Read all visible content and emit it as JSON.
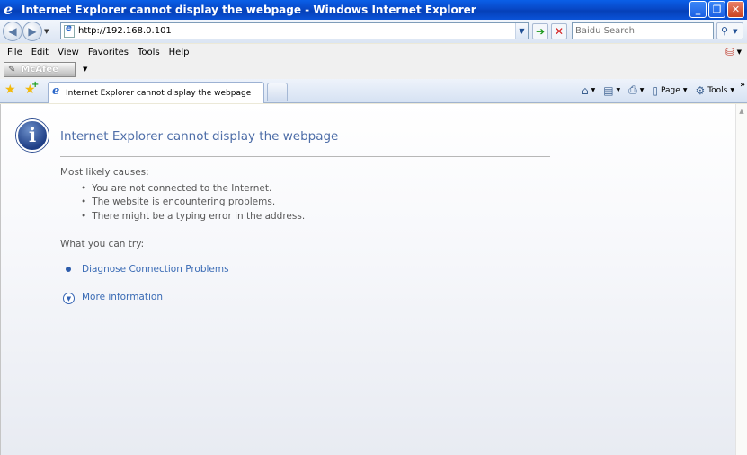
{
  "window": {
    "title": "Internet Explorer cannot display the webpage - Windows Internet Explorer"
  },
  "address_bar": {
    "url": "http://192.168.0.101",
    "search_placeholder": "Baidu Search"
  },
  "menu": {
    "items": [
      "File",
      "Edit",
      "View",
      "Favorites",
      "Tools",
      "Help"
    ]
  },
  "toolbar": {
    "mcafee_label": "McAfee",
    "page_label": "Page",
    "tools_label": "Tools"
  },
  "tabs": [
    {
      "label": "Internet Explorer cannot display the webpage"
    }
  ],
  "content": {
    "title": "Internet Explorer cannot display the webpage",
    "causes_heading": "Most likely causes:",
    "causes": [
      "You are not connected to the Internet.",
      "The website is encountering problems.",
      "There might be a typing error in the address."
    ],
    "try_heading": "What you can try:",
    "diagnose_link": "Diagnose Connection Problems",
    "more_info_link": "More information"
  },
  "colors": {
    "titlebar_blue": "#0848c7",
    "link_blue": "#3a6bb5",
    "heading_blue": "#4e6ea8"
  }
}
